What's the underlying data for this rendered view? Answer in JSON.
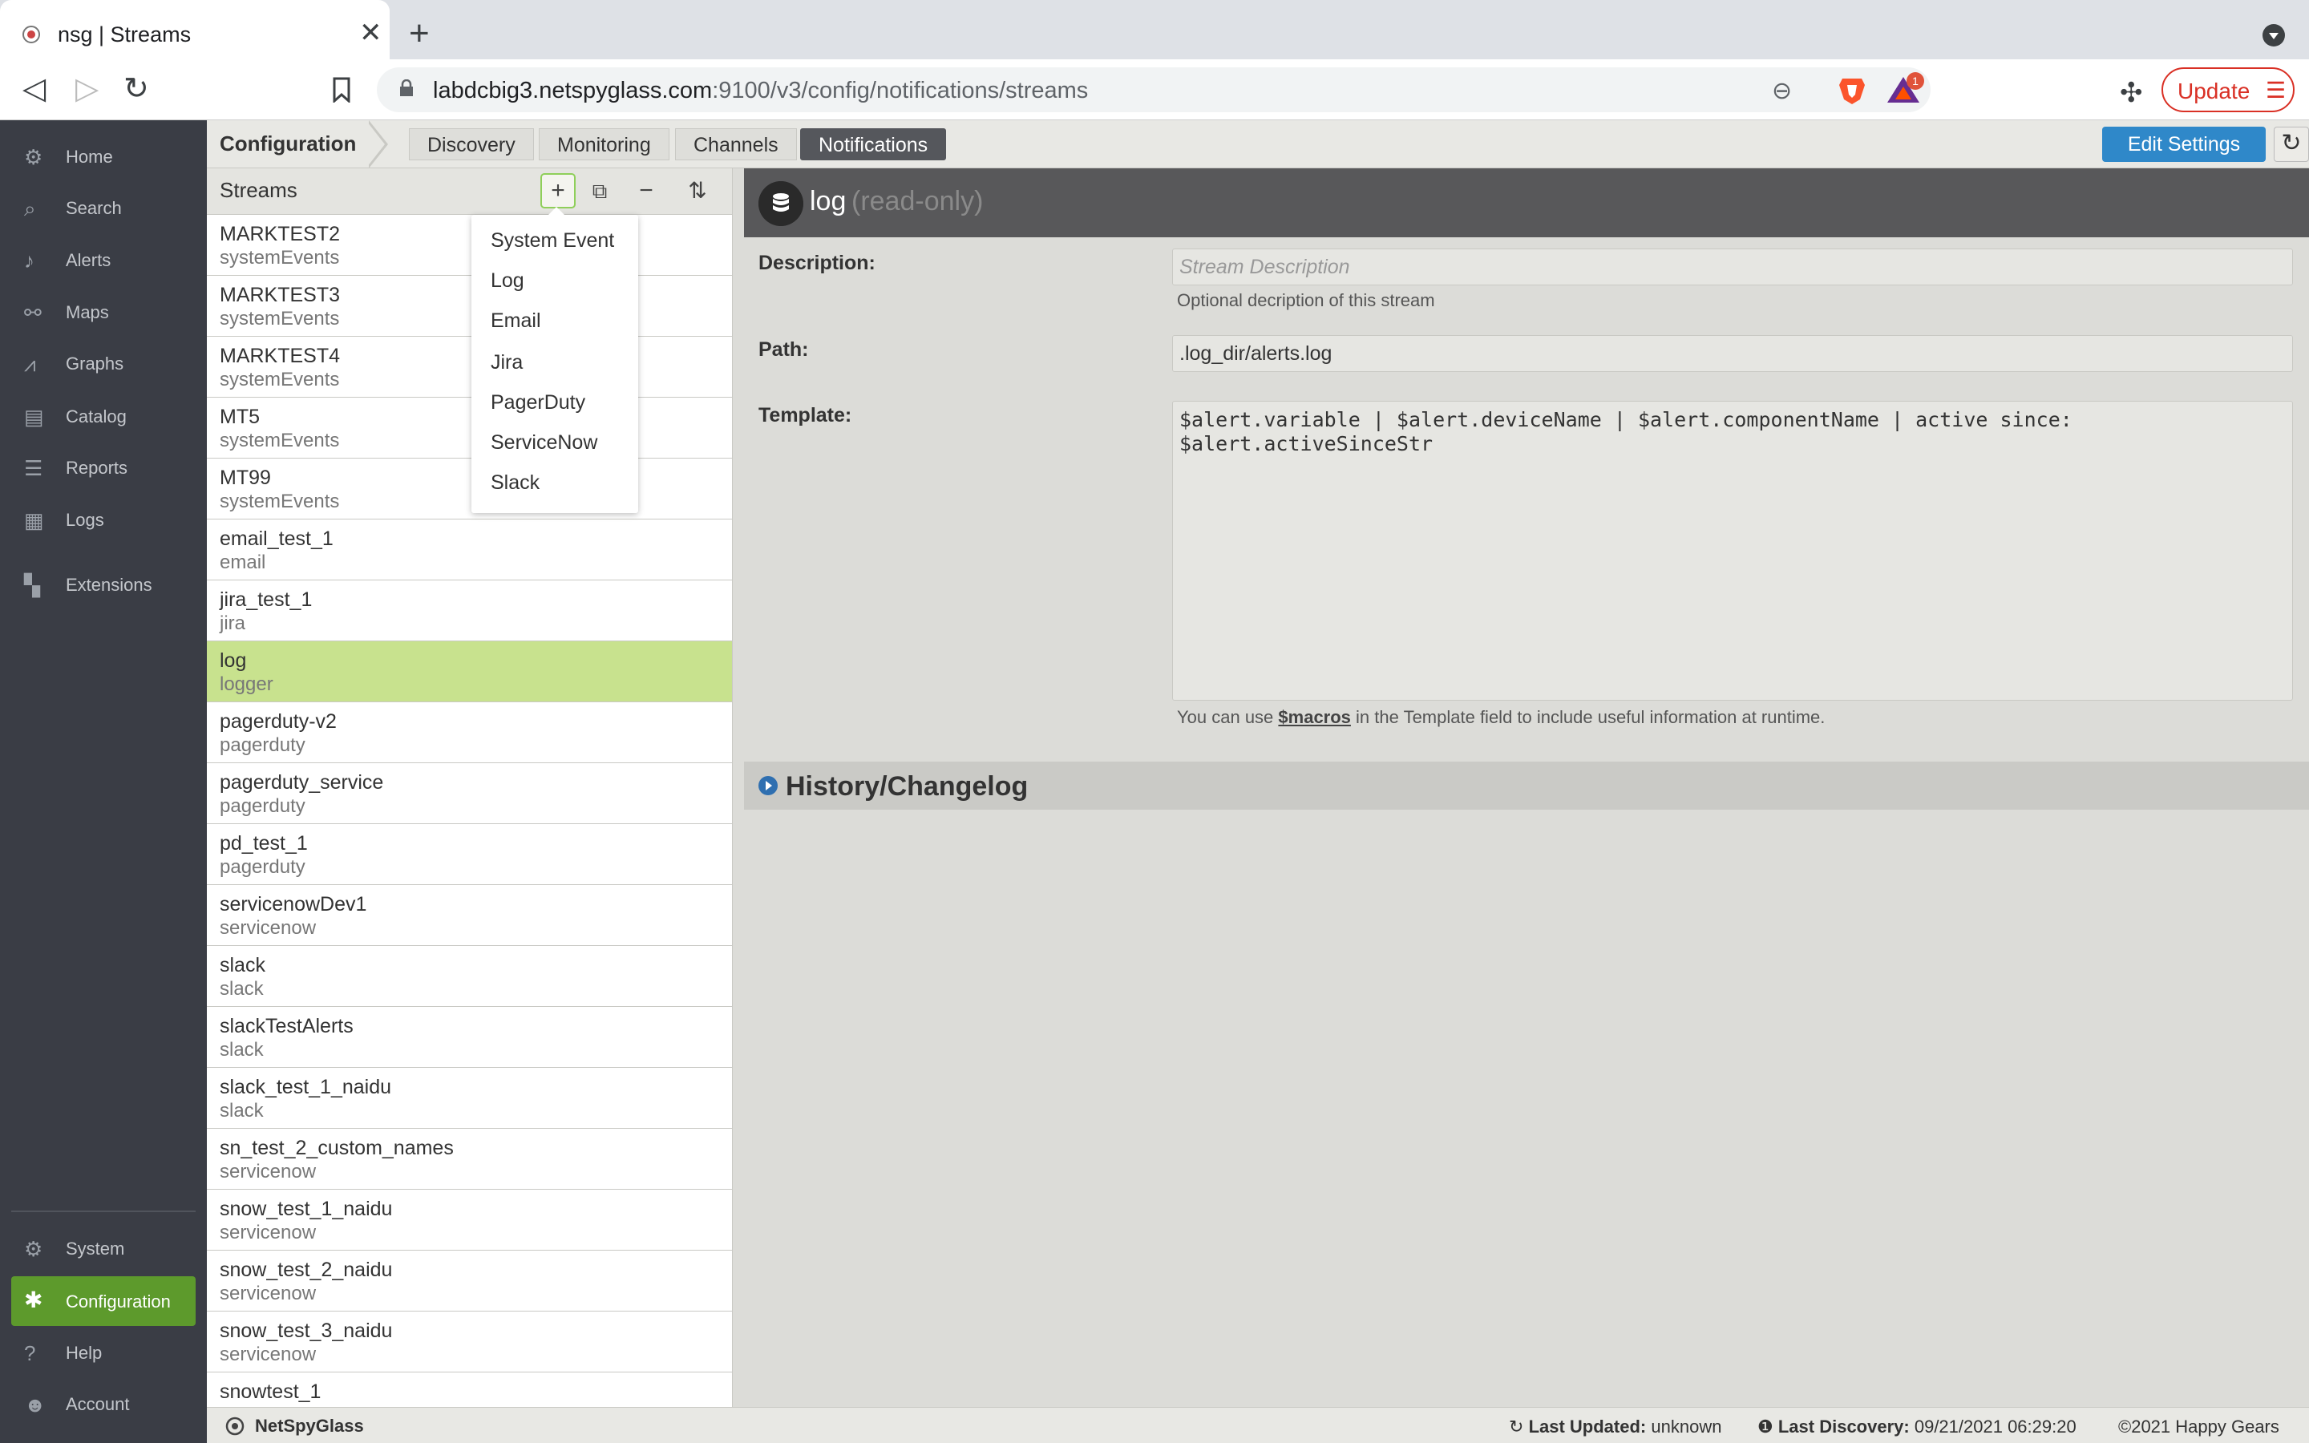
{
  "browser": {
    "tab_title": "nsg | Streams",
    "url_host": "labdcbig3.netspyglass.com",
    "url_path": ":9100/v3/config/notifications/streams",
    "update_label": "Update",
    "notification_count": "1"
  },
  "sidebar": {
    "items": [
      {
        "label": "Home",
        "icon": "home-icon"
      },
      {
        "label": "Search",
        "icon": "search-icon"
      },
      {
        "label": "Alerts",
        "icon": "bell-icon"
      },
      {
        "label": "Maps",
        "icon": "map-icon"
      },
      {
        "label": "Graphs",
        "icon": "graph-icon"
      },
      {
        "label": "Catalog",
        "icon": "catalog-icon"
      },
      {
        "label": "Reports",
        "icon": "reports-icon"
      },
      {
        "label": "Logs",
        "icon": "logs-icon"
      },
      {
        "label": "Extensions",
        "icon": "extensions-icon"
      }
    ],
    "bottom_items": [
      {
        "label": "System",
        "icon": "gear-icon"
      },
      {
        "label": "Configuration",
        "icon": "tools-icon"
      },
      {
        "label": "Help",
        "icon": "help-icon"
      },
      {
        "label": "Account",
        "icon": "account-icon"
      }
    ]
  },
  "config_bar": {
    "title": "Configuration",
    "tabs": [
      "Discovery",
      "Monitoring",
      "Channels",
      "Notifications"
    ],
    "active_tab": "Notifications",
    "edit_settings_label": "Edit Settings"
  },
  "streams": {
    "title": "Streams",
    "items": [
      {
        "name": "MARKTEST2",
        "type": "systemEvents"
      },
      {
        "name": "MARKTEST3",
        "type": "systemEvents"
      },
      {
        "name": "MARKTEST4",
        "type": "systemEvents"
      },
      {
        "name": "MT5",
        "type": "systemEvents"
      },
      {
        "name": "MT99",
        "type": "systemEvents"
      },
      {
        "name": "email_test_1",
        "type": "email"
      },
      {
        "name": "jira_test_1",
        "type": "jira"
      },
      {
        "name": "log",
        "type": "logger"
      },
      {
        "name": "pagerduty-v2",
        "type": "pagerduty"
      },
      {
        "name": "pagerduty_service",
        "type": "pagerduty"
      },
      {
        "name": "pd_test_1",
        "type": "pagerduty"
      },
      {
        "name": "servicenowDev1",
        "type": "servicenow"
      },
      {
        "name": "slack",
        "type": "slack"
      },
      {
        "name": "slackTestAlerts",
        "type": "slack"
      },
      {
        "name": "slack_test_1_naidu",
        "type": "slack"
      },
      {
        "name": "sn_test_2_custom_names",
        "type": "servicenow"
      },
      {
        "name": "snow_test_1_naidu",
        "type": "servicenow"
      },
      {
        "name": "snow_test_2_naidu",
        "type": "servicenow"
      },
      {
        "name": "snow_test_3_naidu",
        "type": "servicenow"
      },
      {
        "name": "snowtest_1",
        "type": ""
      }
    ],
    "selected_index": 7
  },
  "add_menu": {
    "items": [
      "System Event",
      "Log",
      "Email",
      "Jira",
      "PagerDuty",
      "ServiceNow",
      "Slack"
    ]
  },
  "detail": {
    "name": "log",
    "readonly_label": "(read-only)",
    "description_label": "Description:",
    "description_placeholder": "Stream Description",
    "description_help": "Optional decription of this stream",
    "path_label": "Path:",
    "path_value": ".log_dir/alerts.log",
    "template_label": "Template:",
    "template_value": "$alert.variable | $alert.deviceName | $alert.componentName | active since:\n$alert.activeSinceStr",
    "template_help_prefix": "You can use ",
    "template_help_macro": "$macros",
    "template_help_suffix": " in the Template field to include useful information at runtime.",
    "history_label": "History/Changelog"
  },
  "footer": {
    "brand": "NetSpyGlass",
    "last_updated_label": "Last Updated:",
    "last_updated_value": "unknown",
    "last_discovery_label": "Last Discovery:",
    "last_discovery_value": "09/21/2021 06:29:20",
    "copyright": "©2021 Happy Gears"
  },
  "colors": {
    "sidebar_bg": "#3a3d45",
    "accent_green": "#5d9a2c",
    "selected_row": "#c8e28e",
    "edit_button": "#2f88c9"
  }
}
